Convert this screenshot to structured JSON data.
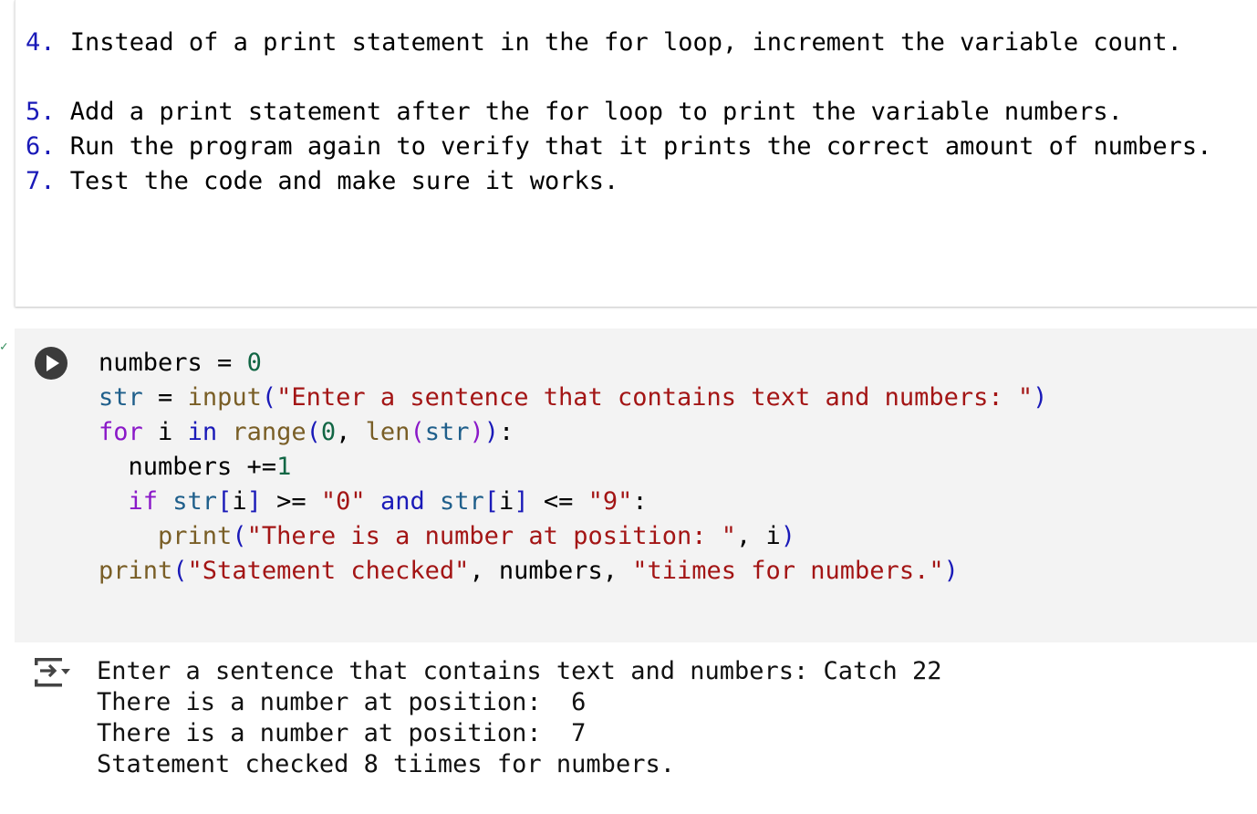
{
  "markdown_cell": {
    "items": [
      {
        "num": "4.",
        "text": "Instead of a print statement in the for loop, increment the variable count."
      },
      {
        "num": "5.",
        "text": "Add a print statement after the for loop to print the variable numbers."
      },
      {
        "num": "6.",
        "text": "Run the program again to verify that it prints the correct amount of numbers."
      },
      {
        "num": "7.",
        "text": "Test the code and make sure it works."
      }
    ]
  },
  "code_cell": {
    "run_icon": "play-icon",
    "status_icon": "checkmark-icon",
    "lines": [
      "numbers = 0",
      "str = input(\"Enter a sentence that contains text and numbers: \")",
      "for i in range(0, len(str)):",
      "  numbers +=1",
      "  if str[i] >= \"0\" and str[i] <= \"9\":",
      "    print(\"There is a number at position: \", i)",
      "print(\"Statement checked\", numbers, \"tiimes for numbers.\")"
    ]
  },
  "output": {
    "icon": "output-toggle-icon",
    "lines": [
      "Enter a sentence that contains text and numbers: Catch 22",
      "There is a number at position:  6",
      "There is a number at position:  7",
      "Statement checked 8 tiimes for numbers."
    ]
  },
  "colors": {
    "keyword": "#8a18c8",
    "keyword_blue": "#1a1ab8",
    "function": "#795e26",
    "variable": "#1f5f8b",
    "number": "#116644",
    "string": "#a31515",
    "code_bg": "#f3f3f3"
  }
}
